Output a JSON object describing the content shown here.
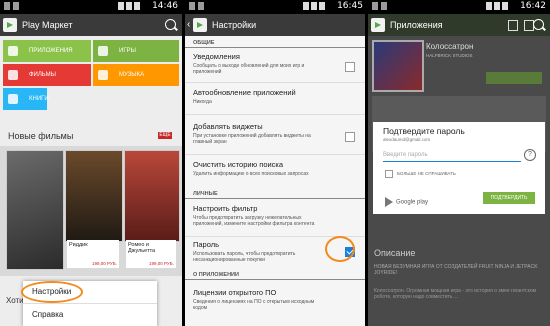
{
  "screen1": {
    "status_time": "14:46",
    "app_title": "Play Маркет",
    "tiles": [
      {
        "label": "ПРИЛОЖЕНИЯ",
        "color": "#8bc34a"
      },
      {
        "label": "ИГРЫ",
        "color": "#7cb342"
      },
      {
        "label": "ФИЛЬМЫ",
        "color": "#e53935"
      },
      {
        "label": "МУЗЫКА",
        "color": "#ff9800"
      },
      {
        "label": "КНИГИ",
        "color": "#29b6f6"
      }
    ],
    "section_title": "Новые фильмы",
    "badge": "ЕЩЕ",
    "posters": [
      {
        "title": "Риддик",
        "price": "199,00 РУБ."
      },
      {
        "title": "Ромео и Джульетта",
        "price": "199,00 РУБ."
      }
    ],
    "truncated_text": "Хоти",
    "popup_items": [
      "Настройки",
      "Справка"
    ]
  },
  "screen2": {
    "status_time": "16:45",
    "app_title": "Настройки",
    "section_general": "ОБЩИЕ",
    "section_personal": "ЛИЧНЫЕ",
    "section_about": "О ПРИЛОЖЕНИИ",
    "rows": [
      {
        "title": "Уведомления",
        "desc": "Сообщать о выходе обновлений для моих игр и приложений",
        "checkbox": true,
        "checked": false
      },
      {
        "title": "Автообновление приложений",
        "desc": "Никогда",
        "checkbox": false,
        "checked": false
      },
      {
        "title": "Добавлять виджеты",
        "desc": "При установке приложений добавлять виджеты на главный экран",
        "checkbox": true,
        "checked": false
      },
      {
        "title": "Очистить историю поиска",
        "desc": "Удалить информацию о всех поисковых запросах",
        "checkbox": false,
        "checked": false
      },
      {
        "title": "Настроить фильтр",
        "desc": "Чтобы предотвратить загрузку нежелательных приложений, измените настройки фильтра контента",
        "checkbox": false,
        "checked": false
      },
      {
        "title": "Пароль",
        "desc": "Использовать пароль, чтобы предотвратить несанкционированные покупки",
        "checkbox": true,
        "checked": true
      },
      {
        "title": "Лицензии открытого ПО",
        "desc": "Сведения о лицензиях на ПО с открытым исходным кодом",
        "checkbox": false,
        "checked": false
      }
    ]
  },
  "screen3": {
    "status_time": "16:42",
    "app_title": "Приложения",
    "app_name": "Колоссатрон",
    "developer": "HALFBRICK STUDIOS",
    "dialog_title": "Подтвердите пароль",
    "account": "alexdaumd@gmail.com",
    "password_placeholder": "Введите пароль",
    "help_symbol": "?",
    "no_ask_label": "БОЛЬШЕ НЕ СПРАШИВАТЬ",
    "google_play": "Google play",
    "confirm_label": "ПОДТВЕРДИТЬ",
    "description_header": "Описание",
    "description_text": "НОВАЯ БЕЗУМНАЯ ИГРА ОТ СОЗДАТЕЛЕЙ FRUIT NINJA И JETPACK JOYRIDE!",
    "description_text2": "Колоссатрон. Огромная мощная игра - это история о змее гигантском роботе, которую надо совместить ..."
  }
}
